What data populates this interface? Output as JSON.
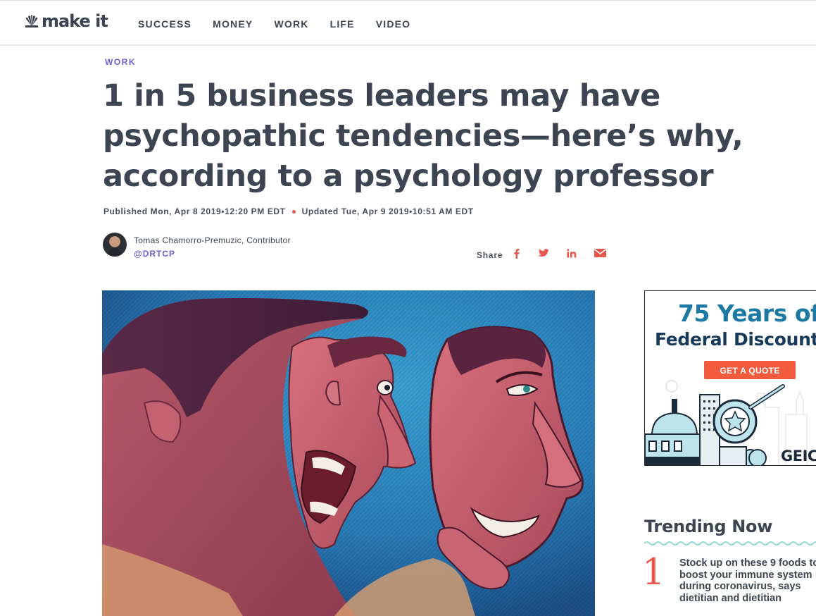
{
  "header": {
    "logo_text": "make it",
    "nav": [
      "SUCCESS",
      "MONEY",
      "WORK",
      "LIFE",
      "VIDEO"
    ]
  },
  "article": {
    "kicker": "WORK",
    "headline": "1 in 5 business leaders may have psychopathic tendencies—here’s why, according to a psychology professor",
    "published": "Published Mon, Apr 8 2019•12:20 PM EDT",
    "updated": "Updated Tue, Apr 9 2019•10:51 AM EDT",
    "author": "Tomas Chamorro-Premuzic, Contributor",
    "author_handle": "@DRTCP",
    "share_label": "Share",
    "share_icons": [
      "facebook-icon",
      "twitter-icon",
      "linkedin-icon",
      "email-icon"
    ]
  },
  "ad": {
    "title": "75 Years of",
    "subtitle": "Federal Discount",
    "cta": "GET A QUOTE",
    "brand": "GEICO"
  },
  "trending": {
    "title": "Trending Now",
    "items": [
      {
        "rank": "1",
        "text": "Stock up on these 9 foods to boost your immune system during coronavirus, says dietitian and dietitian"
      }
    ]
  },
  "colors": {
    "accent_purple": "#6a5fd6",
    "accent_red": "#e8574e",
    "text_dark": "#3d4452",
    "ad_blue": "#1b79a3",
    "ad_navy": "#183a5a",
    "ad_orange": "#f15a3c"
  }
}
